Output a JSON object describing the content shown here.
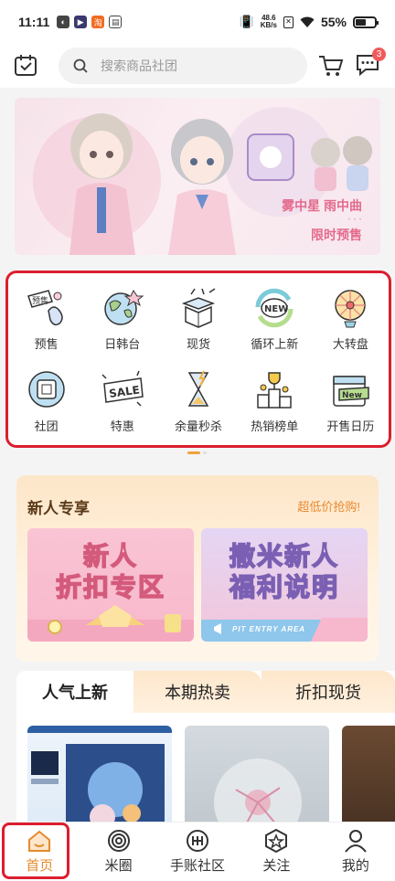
{
  "status_bar": {
    "time": "11:11",
    "net_speed_value": "48.6",
    "net_speed_unit": "KB/s",
    "battery": "55%",
    "battery_level": 0.55
  },
  "header": {
    "calendar_icon": "calendar-check-icon",
    "search_placeholder": "搜索商品社团",
    "cart_icon": "cart-icon",
    "message_icon": "chat-bubble-icon",
    "message_badge": "3"
  },
  "banner": {
    "line1": "雾中星 雨中曲",
    "line2": "限时预售"
  },
  "categories": [
    {
      "label": "预售",
      "icon": "presale-icon"
    },
    {
      "label": "日韩台",
      "icon": "globe-icon"
    },
    {
      "label": "现货",
      "icon": "gift-box-icon"
    },
    {
      "label": "循环上新",
      "icon": "new-cycle-icon"
    },
    {
      "label": "大转盘",
      "icon": "wheel-icon"
    },
    {
      "label": "社团",
      "icon": "club-icon"
    },
    {
      "label": "特惠",
      "icon": "sale-tag-icon"
    },
    {
      "label": "余量秒杀",
      "icon": "hourglass-icon"
    },
    {
      "label": "热销榜单",
      "icon": "trophy-icon"
    },
    {
      "label": "开售日历",
      "icon": "new-calendar-icon"
    }
  ],
  "newbie": {
    "title": "新人专享",
    "more": "超低价抢购!",
    "card1_line1": "新人",
    "card1_line2": "折扣专区",
    "card2_line1": "撒米新人",
    "card2_line2": "福利说明",
    "card2_caption": "PIT ENTRY AREA"
  },
  "tabs": [
    {
      "label": "人气上新"
    },
    {
      "label": "本期热卖"
    },
    {
      "label": "折扣现货"
    }
  ],
  "bottom_nav": [
    {
      "label": "首页",
      "icon": "home-icon"
    },
    {
      "label": "米圈",
      "icon": "ring-icon"
    },
    {
      "label": "手账社区",
      "icon": "journal-icon"
    },
    {
      "label": "关注",
      "icon": "star-badge-icon"
    },
    {
      "label": "我的",
      "icon": "person-icon"
    }
  ],
  "colors": {
    "accent": "#e48b2e",
    "highlight_border": "#dc1e2e",
    "badge": "#f05a5a"
  }
}
